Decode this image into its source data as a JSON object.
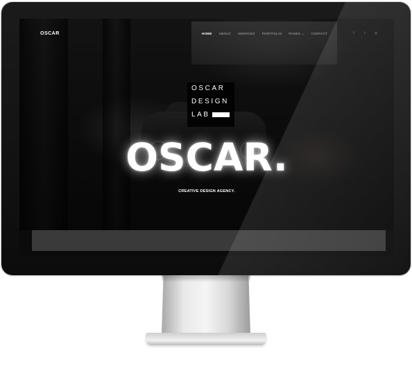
{
  "nav": {
    "logo": "OSCAR",
    "items": [
      {
        "label": "HOME",
        "active": true
      },
      {
        "label": "ABOUT",
        "active": false
      },
      {
        "label": "SERVICES",
        "active": false
      },
      {
        "label": "PORTFOLIO",
        "active": false
      },
      {
        "label": "PAGES ⌄",
        "active": false
      },
      {
        "label": "CONTACT",
        "active": false
      }
    ],
    "social_icons": [
      "f",
      "t",
      "◎"
    ]
  },
  "brand_box": {
    "line1": "OSCAR",
    "line2": "DESIGN",
    "line3": "LAB"
  },
  "hero": {
    "headline": "OSCAR.",
    "tagline": "CREATIVE DESIGN AGENCY."
  },
  "colors": {
    "background": "#0b0b0b",
    "text": "#ffffff",
    "menu_inactive": "#8d8d8d",
    "strip": "#3a3a3a"
  }
}
